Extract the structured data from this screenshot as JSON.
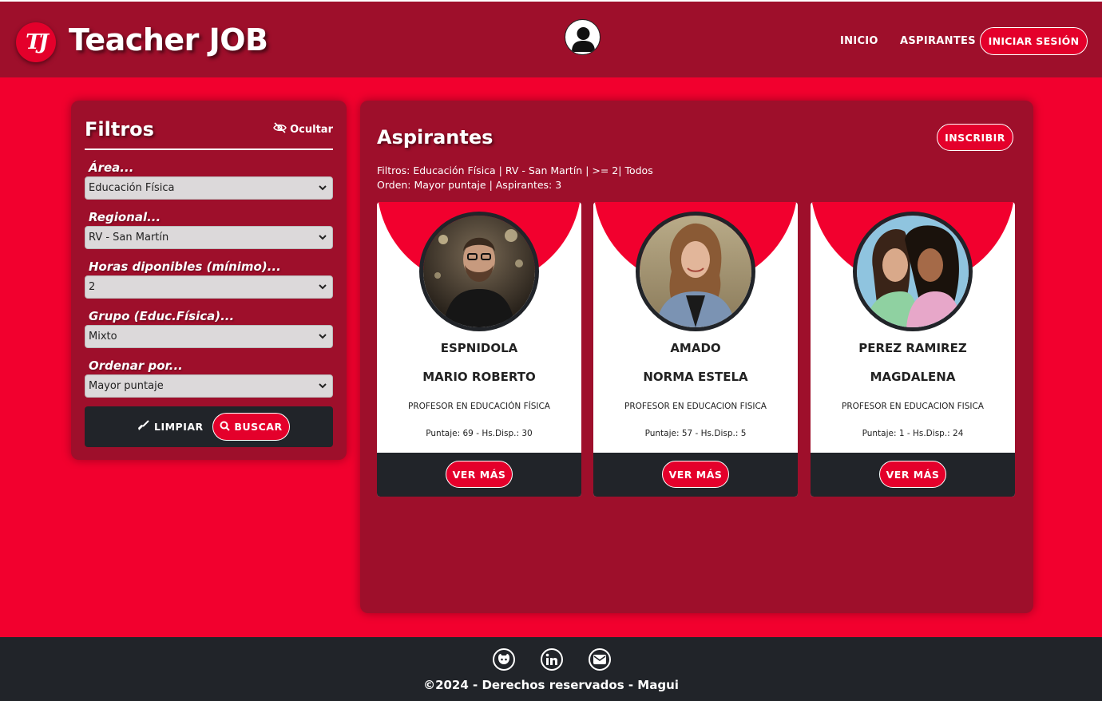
{
  "header": {
    "logo_text": "TJ",
    "brand": "Teacher JOB",
    "nav": {
      "inicio": "INICIO",
      "aspirantes": "ASPIRANTES",
      "login": "INICIAR SESIÓN"
    }
  },
  "filters": {
    "title": "Filtros",
    "hide_label": "Ocultar",
    "fields": [
      {
        "label": "Área...",
        "value": "Educación Física"
      },
      {
        "label": "Regional...",
        "value": "RV - San Martín"
      },
      {
        "label": "Horas diponibles (mínimo)...",
        "value": "2"
      },
      {
        "label": "Grupo (Educ.Física)...",
        "value": "Mixto"
      },
      {
        "label": "Ordenar por...",
        "value": "Mayor puntaje"
      }
    ],
    "clear_label": "LIMPIAR",
    "search_label": "BUSCAR"
  },
  "main": {
    "title": "Aspirantes",
    "enroll_label": "INSCRIBIR",
    "filters_summary": "Filtros: Educación Física | RV - San Martín | >= 2| Todos",
    "order_summary": "Orden: Mayor puntaje | Aspirantes: 3"
  },
  "cards": [
    {
      "surname": "ESPNIDOLA",
      "name": "MARIO ROBERTO",
      "title": "PROFESOR EN EDUCACIÓN FÍSICA",
      "score": "Puntaje: 69 - Hs.Disp.: 30",
      "more": "VER MÁS"
    },
    {
      "surname": "AMADO",
      "name": "NORMA ESTELA",
      "title": "PROFESOR EN EDUCACION FISICA",
      "score": "Puntaje: 57 - Hs.Disp.: 5",
      "more": "VER MÁS"
    },
    {
      "surname": "PEREZ RAMIREZ",
      "name": "MAGDALENA",
      "title": "PROFESOR EN EDUCACION FISICA",
      "score": "Puntaje: 1 - Hs.Disp.: 24",
      "more": "VER MÁS"
    }
  ],
  "footer": {
    "copyright": "©2024 - Derechos reservados - Magui",
    "icons": [
      "github-icon",
      "linkedin-icon",
      "email-icon"
    ]
  },
  "colors": {
    "brand_red": "#e4002b",
    "dark_red": "#9e0f2b",
    "page_red": "#f2002e",
    "dark": "#212429"
  }
}
